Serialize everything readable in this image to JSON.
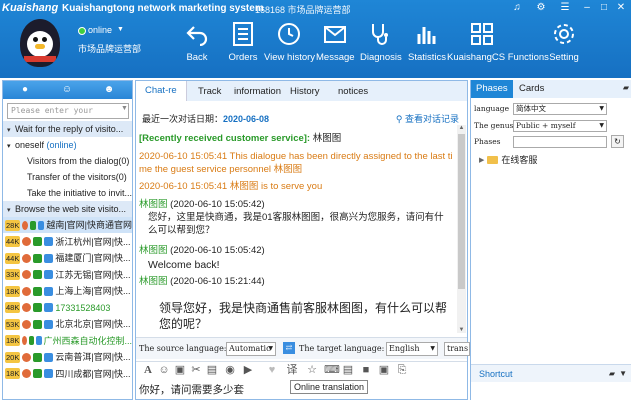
{
  "app": {
    "logo": "Kuaishang",
    "title": "Kuaishangtong network marketing system",
    "id_label": "168168 市场品牌运营部"
  },
  "user": {
    "status": "online",
    "name": "市场品牌运营部"
  },
  "toolbar": [
    {
      "label": "Back",
      "icon": "back-arrow-icon"
    },
    {
      "label": "Orders",
      "icon": "orders-list-icon"
    },
    {
      "label": "View history",
      "icon": "clock-icon"
    },
    {
      "label": "Message",
      "icon": "mail-icon"
    },
    {
      "label": "Diagnosis",
      "icon": "stethoscope-icon"
    },
    {
      "label": "Statistics",
      "icon": "bar-chart-icon"
    },
    {
      "label": "KuaishangCS Functions",
      "icon": "grid-functions-icon"
    },
    {
      "label": "Setting",
      "icon": "gear-icon"
    }
  ],
  "sidebar": {
    "search_placeholder": "Please enter your",
    "groups": [
      {
        "label": "Wait for the reply of visito..."
      },
      {
        "label": "oneself",
        "suffix": "(online)"
      },
      {
        "label": "Visitors from the dialog(0)"
      },
      {
        "label": "Transfer of the visitors(0)"
      },
      {
        "label": "Take the initiative to invit..."
      },
      {
        "label": "Browse the web site visito..."
      }
    ],
    "visitors": [
      {
        "badge": "28K",
        "badge_color": "#f4c542",
        "name": "越南|官网|快商通官网",
        "color": "#222",
        "selected": true
      },
      {
        "badge": "44K",
        "badge_color": "#f4c542",
        "name": "浙江杭州|官网|快...",
        "color": "#222"
      },
      {
        "badge": "44K",
        "badge_color": "#f4c542",
        "name": "福建厦门|官网|快...",
        "color": "#222"
      },
      {
        "badge": "33K",
        "badge_color": "#f4c542",
        "name": "江苏无锡|官网|快...",
        "color": "#222"
      },
      {
        "badge": "18K",
        "badge_color": "#f4c542",
        "name": "上海上海|官网|快...",
        "color": "#222"
      },
      {
        "badge": "48K",
        "badge_color": "#f4c542",
        "name": "17331528403",
        "color": "#2a9a2a"
      },
      {
        "badge": "53K",
        "badge_color": "#f4c542",
        "name": "北京北京|官网|快...",
        "color": "#222"
      },
      {
        "badge": "18K",
        "badge_color": "#f4c542",
        "name": "广州西森自动化控制...",
        "color": "#2a9a2a"
      },
      {
        "badge": "20K",
        "badge_color": "#f4c542",
        "name": "云南普洱|官网|快...",
        "color": "#222"
      },
      {
        "badge": "18K",
        "badge_color": "#f4c542",
        "name": "四川成都|官网|快...",
        "color": "#222"
      }
    ]
  },
  "chat": {
    "tabs": [
      "Chat-re",
      "Track",
      "information",
      "History",
      "notices"
    ],
    "header_label": "最近一次对话日期：",
    "header_date": "2020-06-08",
    "view_record": "查看对话记录",
    "messages": [
      {
        "kind": "notice",
        "prefix": "[Recently received customer service]:",
        "text": " 林图图"
      },
      {
        "kind": "system",
        "text": "2020-06-10 15:05:41 This dialogue has been directly assigned to the last ti me the guest service personnel 林图图"
      },
      {
        "kind": "system",
        "text": "2020-06-10 15:05:41 林图图 is to serve you"
      },
      {
        "kind": "agent",
        "who": "林图图",
        "time": "(2020-06-10 15:05:42)",
        "text": "您好，这里是快商通，我是01客服林图图，很高兴为您服务，请问有什么可以帮到您？"
      },
      {
        "kind": "agent",
        "who": "林图图",
        "time": "(2020-06-10 15:05:42)",
        "text": "Welcome back!"
      },
      {
        "kind": "agent",
        "who": "林图图",
        "time": "(2020-06-10 15:21:44)",
        "text": "领导您好，我是快商通售前客服林图图，有什么可以帮您的呢？"
      }
    ],
    "translation": {
      "source_label": "The source language:",
      "source_value": "Automatic",
      "target_label": "The target language:",
      "target_value": "English",
      "translate_button": "trans"
    },
    "tooltip": "Online translation",
    "input_text": "你好，请问需要多少套"
  },
  "right_panel": {
    "tabs": [
      "Phases",
      "Cards"
    ],
    "language_label": "language",
    "language_value": "简体中文",
    "genus_label": "The genus",
    "genus_value": "Public + myself",
    "phases_label": "Phases",
    "tree_item": "在线客服",
    "shortcut": "Shortcut"
  }
}
